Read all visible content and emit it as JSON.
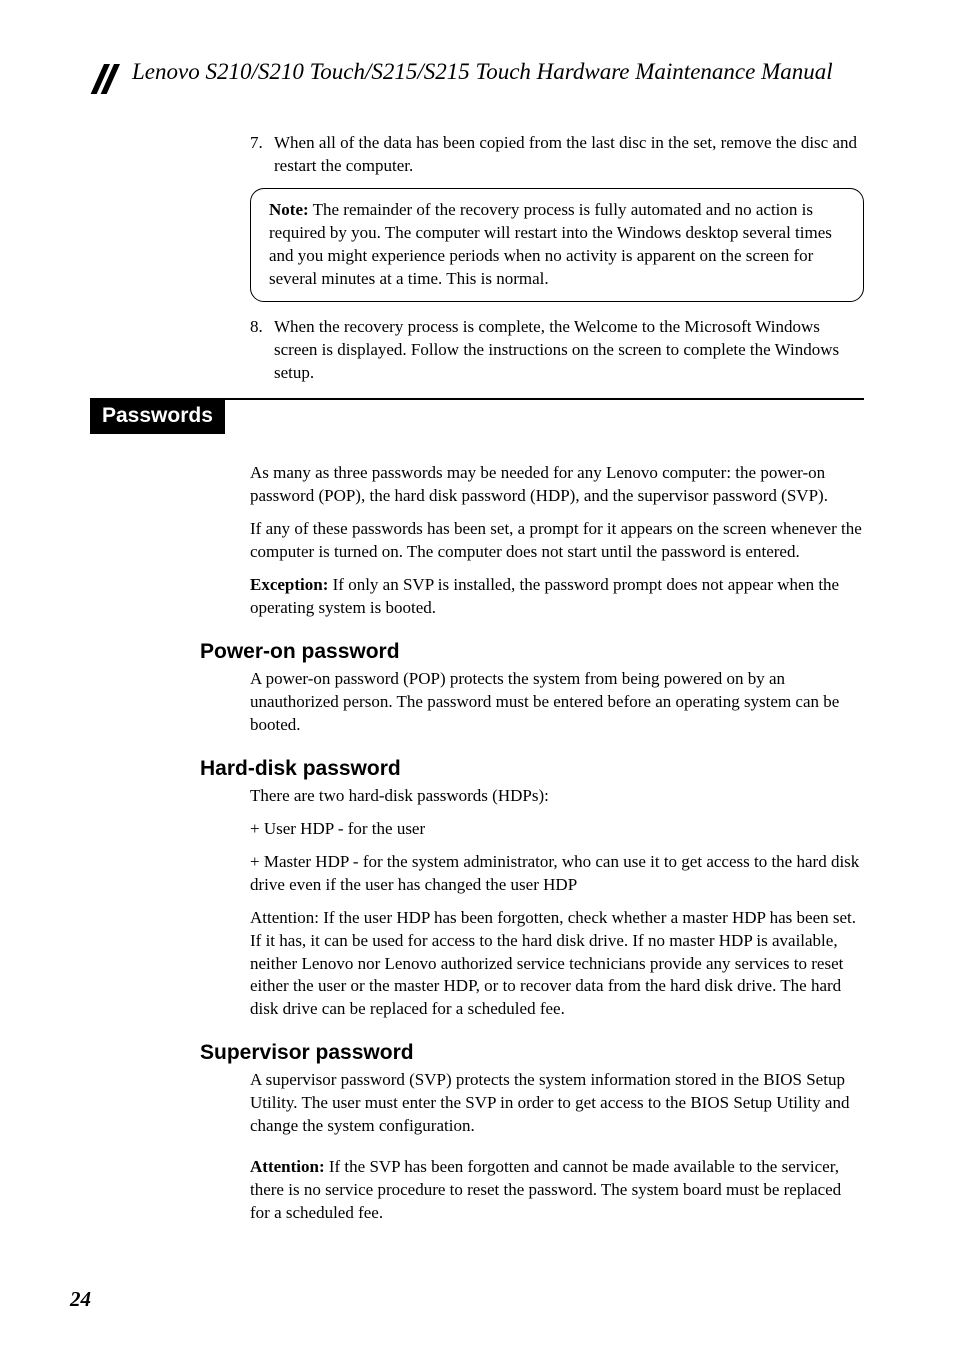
{
  "title": "Lenovo S210/S210 Touch/S215/S215 Touch Hardware Maintenance Manual",
  "step7_num": "7.",
  "step7": "When all of the data has been copied from the last disc in the set, remove the disc and restart the computer.",
  "note_label": "Note:",
  "note_body": " The remainder of the recovery process is fully automated and no action is required by you. The computer will restart into the Windows desktop several times and you might experience periods when no activity is apparent on the screen for several minutes at a time. This is normal.",
  "step8_num": "8.",
  "step8": "When the recovery process is complete, the Welcome to the Microsoft Windows screen is displayed. Follow the instructions on the screen to complete the Windows setup.",
  "section": "Passwords",
  "pw_intro1": "As many as three passwords may be needed for any Lenovo computer: the power-on password (POP), the hard disk password (HDP), and the supervisor password (SVP).",
  "pw_intro2": "If any of these passwords has been set, a prompt for it appears on the screen whenever the computer is turned on. The computer does not start until the password is entered.",
  "exc_label": "Exception:",
  "exc_body": " If only an SVP is installed, the password prompt does not appear when the operating system is booted.",
  "pop_head": "Power-on password",
  "pop_body": "A power-on password (POP) protects the system from being powered on by an unauthorized person. The password must be entered before an operating system can be booted.",
  "hdp_head": "Hard-disk password",
  "hdp1": "There are two hard-disk passwords (HDPs):",
  "hdp2": "+ User HDP - for the user",
  "hdp3": "+ Master HDP - for the system administrator, who can use it to get access to the hard disk drive even if the user has changed the user HDP",
  "hdp4": "Attention: If the user HDP has been forgotten, check whether a master HDP has been set. If it has, it can be used for access to the hard disk drive. If no master HDP is available, neither Lenovo nor Lenovo authorized service technicians provide any services to reset either the user or the master HDP, or to recover data from the hard disk drive. The hard disk drive can be replaced for a scheduled fee.",
  "svp_head": "Supervisor password",
  "svp1": "A supervisor password (SVP) protects the system information stored in the BIOS Setup Utility. The user must enter the SVP in order to get access to the BIOS Setup Utility and change the system configuration.",
  "att_label": "Attention:",
  "att_body": " If the SVP has been forgotten and cannot be made available to the servicer, there is no service procedure to reset the password. The system board must be replaced for a scheduled fee.",
  "page": "24"
}
